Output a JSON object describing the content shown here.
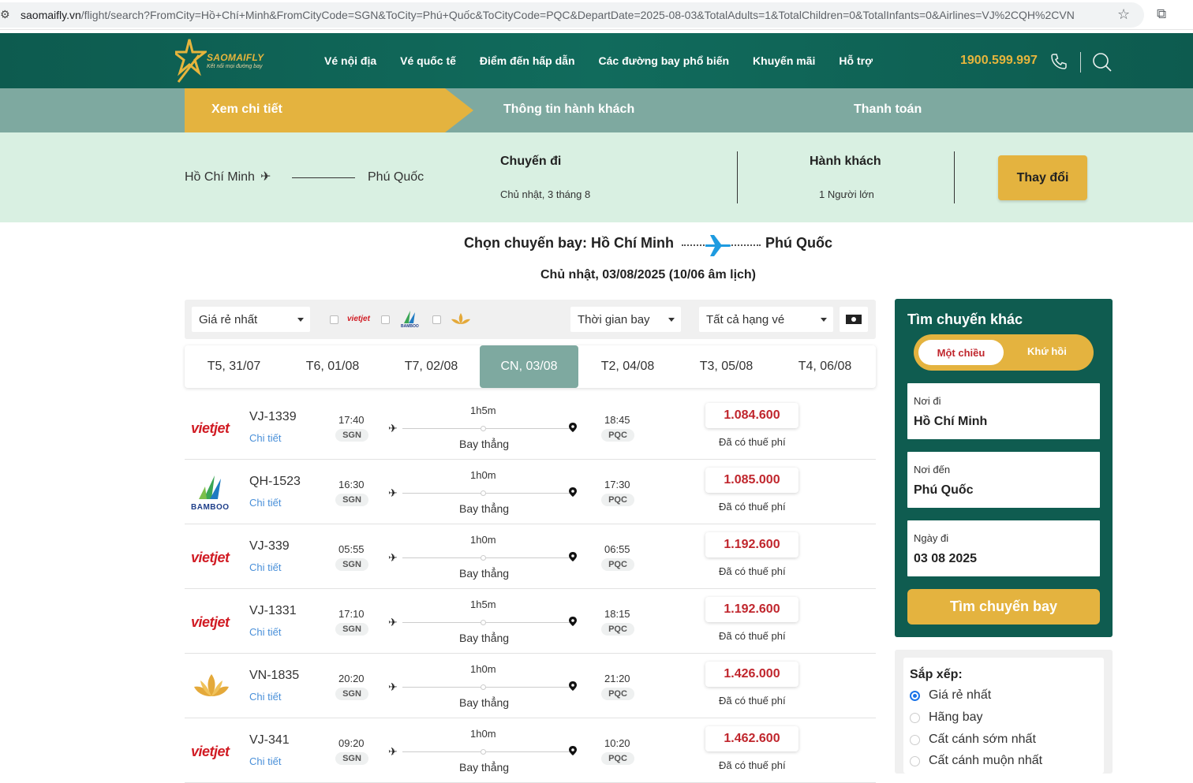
{
  "browser": {
    "url_host": "saomaifly.vn",
    "url_path": "/flight/search?FromCity=Hồ+Chí+Minh&FromCityCode=SGN&ToCity=Phú+Quốc&ToCityCode=PQC&DepartDate=2025-08-03&TotalAdults=1&TotalChildren=0&TotalInfants=0&Airlines=VJ%2CQH%2CVN"
  },
  "header": {
    "brand": "SAOMAIFLY",
    "tagline": "Kết nối mọi đường bay",
    "nav": [
      "Vé nội địa",
      "Vé quốc tế",
      "Điểm đến hấp dẫn",
      "Các đường bay phổ biến",
      "Khuyến mãi",
      "Hỗ trợ"
    ],
    "hotline": "1900.599.997"
  },
  "steps": [
    "Xem chi tiết",
    "Thông tin hành khách",
    "Thanh toán"
  ],
  "summary": {
    "from": "Hồ Chí Minh",
    "to": "Phú Quốc",
    "trip_label": "Chuyến đi",
    "trip_date": "Chủ nhật, 3 tháng 8",
    "pax_label": "Hành khách",
    "pax_value": "1 Người lớn",
    "change_button": "Thay đổi"
  },
  "heading": {
    "prefix": "Chọn chuyến bay: Hồ Chí Minh",
    "to": "Phú Quốc",
    "date": "Chủ nhật, 03/08/2025 (10/06 âm lịch)"
  },
  "filters": {
    "sort": "Giá rẻ nhất",
    "time": "Thời gian bay",
    "class": "Tất cả hạng vé",
    "vietjet_label": "vietjet",
    "bamboo_label": "BAMBOO"
  },
  "dates": [
    "T5, 31/07",
    "T6, 01/08",
    "T7, 02/08",
    "CN, 03/08",
    "T2, 04/08",
    "T3, 05/08",
    "T4, 06/08"
  ],
  "active_date_index": 3,
  "flights": [
    {
      "airline": "vietjet",
      "code": "VJ-1339",
      "detail": "Chi tiết",
      "dep_time": "17:40",
      "dep_airport": "SGN",
      "duration": "1h5m",
      "stops": "Bay thẳng",
      "arr_time": "18:45",
      "arr_airport": "PQC",
      "price": "1.084.600",
      "tax": "Đã có thuế phí"
    },
    {
      "airline": "bamboo",
      "code": "QH-1523",
      "detail": "Chi tiết",
      "dep_time": "16:30",
      "dep_airport": "SGN",
      "duration": "1h0m",
      "stops": "Bay thẳng",
      "arr_time": "17:30",
      "arr_airport": "PQC",
      "price": "1.085.000",
      "tax": "Đã có thuế phí"
    },
    {
      "airline": "vietjet",
      "code": "VJ-339",
      "detail": "Chi tiết",
      "dep_time": "05:55",
      "dep_airport": "SGN",
      "duration": "1h0m",
      "stops": "Bay thẳng",
      "arr_time": "06:55",
      "arr_airport": "PQC",
      "price": "1.192.600",
      "tax": "Đã có thuế phí"
    },
    {
      "airline": "vietjet",
      "code": "VJ-1331",
      "detail": "Chi tiết",
      "dep_time": "17:10",
      "dep_airport": "SGN",
      "duration": "1h5m",
      "stops": "Bay thẳng",
      "arr_time": "18:15",
      "arr_airport": "PQC",
      "price": "1.192.600",
      "tax": "Đã có thuế phí"
    },
    {
      "airline": "vietnamairlines",
      "code": "VN-1835",
      "detail": "Chi tiết",
      "dep_time": "20:20",
      "dep_airport": "SGN",
      "duration": "1h0m",
      "stops": "Bay thẳng",
      "arr_time": "21:20",
      "arr_airport": "PQC",
      "price": "1.426.000",
      "tax": "Đã có thuế phí"
    },
    {
      "airline": "vietjet",
      "code": "VJ-341",
      "detail": "Chi tiết",
      "dep_time": "09:20",
      "dep_airport": "SGN",
      "duration": "1h0m",
      "stops": "Bay thẳng",
      "arr_time": "10:20",
      "arr_airport": "PQC",
      "price": "1.462.600",
      "tax": "Đã có thuế phí"
    }
  ],
  "search_panel": {
    "title": "Tìm chuyến khác",
    "oneway": "Một chiều",
    "roundtrip": "Khứ hồi",
    "from_label": "Nơi đi",
    "from_value": "Hồ Chí Minh",
    "to_label": "Nơi đến",
    "to_value": "Phú Quốc",
    "date_label": "Ngày đi",
    "date_value": "03 08 2025",
    "search_button": "Tìm chuyến bay"
  },
  "sort_panel": {
    "title": "Sắp xếp:",
    "options": [
      "Giá rẻ nhất",
      "Hãng bay",
      "Cất cánh sớm nhất",
      "Cất cánh muộn nhất"
    ],
    "selected_index": 0
  },
  "colors": {
    "brand_green": "#0f5c50",
    "accent_gold": "#e4b33f",
    "step_teal": "#7ea9a0",
    "price_red": "#c0262d"
  }
}
